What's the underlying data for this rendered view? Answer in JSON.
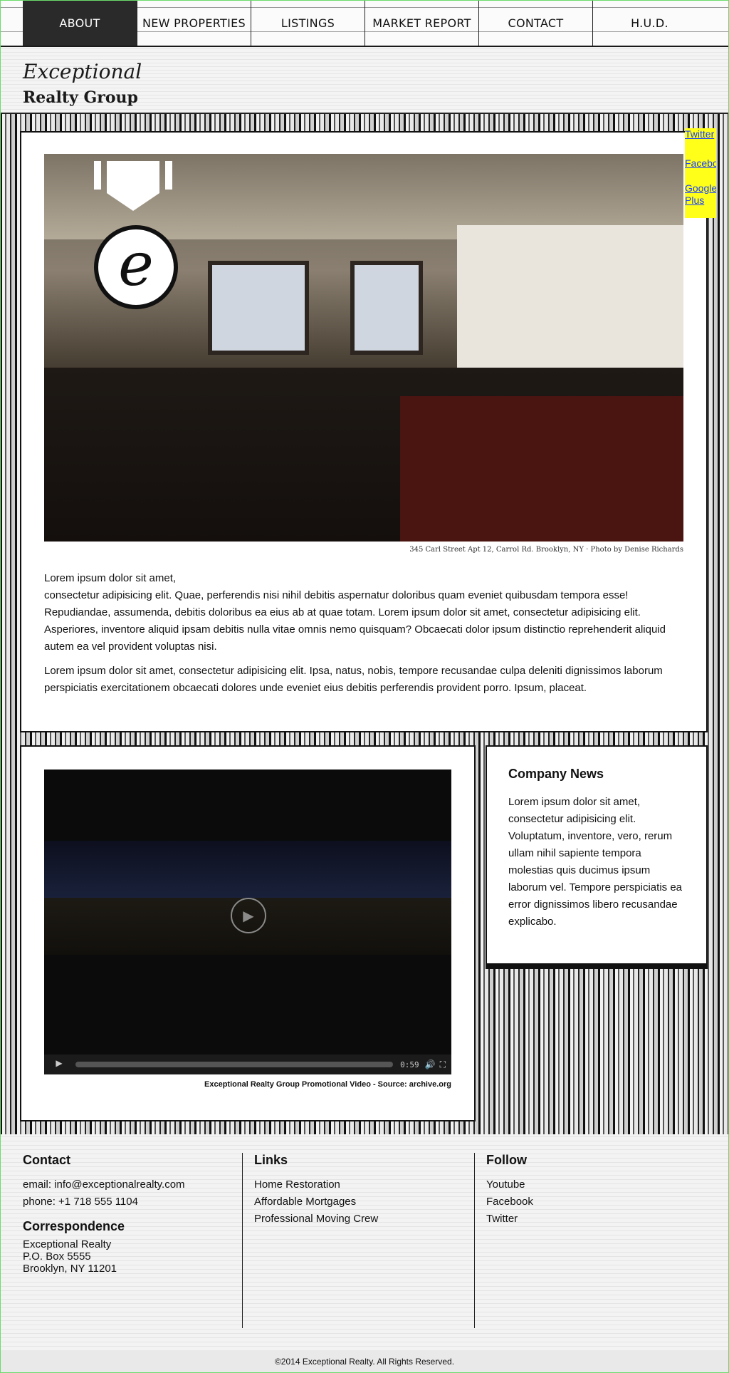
{
  "nav": {
    "items": [
      {
        "label": "ABOUT",
        "active": true
      },
      {
        "label": "NEW PROPERTIES",
        "active": false
      },
      {
        "label": "LISTINGS",
        "active": false
      },
      {
        "label": "MARKET REPORT",
        "active": false
      },
      {
        "label": "CONTACT",
        "active": false
      },
      {
        "label": "H.U.D.",
        "active": false
      }
    ]
  },
  "brand": {
    "script": "Exceptional",
    "name": "Realty Group",
    "badge_letter": "e"
  },
  "social": {
    "twitter": "Twitter",
    "facebook": "Facebook",
    "google": "Google Plus"
  },
  "main": {
    "photo_caption": "345 Carl Street Apt 12, Carrol Rd. Brooklyn, NY · Photo by Denise Richards",
    "paragraph1_lead": "Lorem ipsum dolor sit amet,",
    "paragraph1": "consectetur adipisicing elit. Quae, perferendis nisi nihil debitis aspernatur doloribus quam eveniet quibusdam tempora esse! Repudiandae, assumenda, debitis doloribus ea eius ab at quae totam. Lorem ipsum dolor sit amet, consectetur adipisicing elit. Asperiores, inventore aliquid ipsam debitis nulla vitae omnis nemo quisquam? Obcaecati dolor ipsum distinctio reprehenderit aliquid autem ea vel provident voluptas nisi.",
    "paragraph2": "Lorem ipsum dolor sit amet, consectetur adipisicing elit. Ipsa, natus, nobis, tempore recusandae culpa deleniti dignissimos laborum perspiciatis exercitationem obcaecati dolores unde eveniet eius debitis perferendis provident porro. Ipsum, placeat."
  },
  "video": {
    "time": "0:59",
    "caption": "Exceptional Realty Group Promotional Video - Source: archive.org",
    "play_icon": "play-icon"
  },
  "news": {
    "title": "Company News",
    "body": "Lorem ipsum dolor sit amet, consectetur adipisicing elit. Voluptatum, inventore, vero, rerum ullam nihil sapiente tempora molestias quis ducimus ipsum laborum vel. Tempore perspiciatis ea error dignissimos libero recusandae explicabo."
  },
  "footer": {
    "contact": {
      "title": "Contact",
      "email": "email: info@exceptionalrealty.com",
      "phone": "phone: +1 718 555 1104"
    },
    "correspondence": {
      "title": "Correspondence",
      "line1": "Exceptional Realty",
      "line2": "P.O. Box 5555",
      "line3": "Brooklyn, NY 11201"
    },
    "links": {
      "title": "Links",
      "items": [
        "Home Restoration",
        "Affordable Mortgages",
        "Professional Moving Crew"
      ]
    },
    "follow": {
      "title": "Follow",
      "items": [
        "Youtube",
        "Facebook",
        "Twitter"
      ]
    }
  },
  "copyright": "©2014 Exceptional Realty. All Rights Reserved."
}
